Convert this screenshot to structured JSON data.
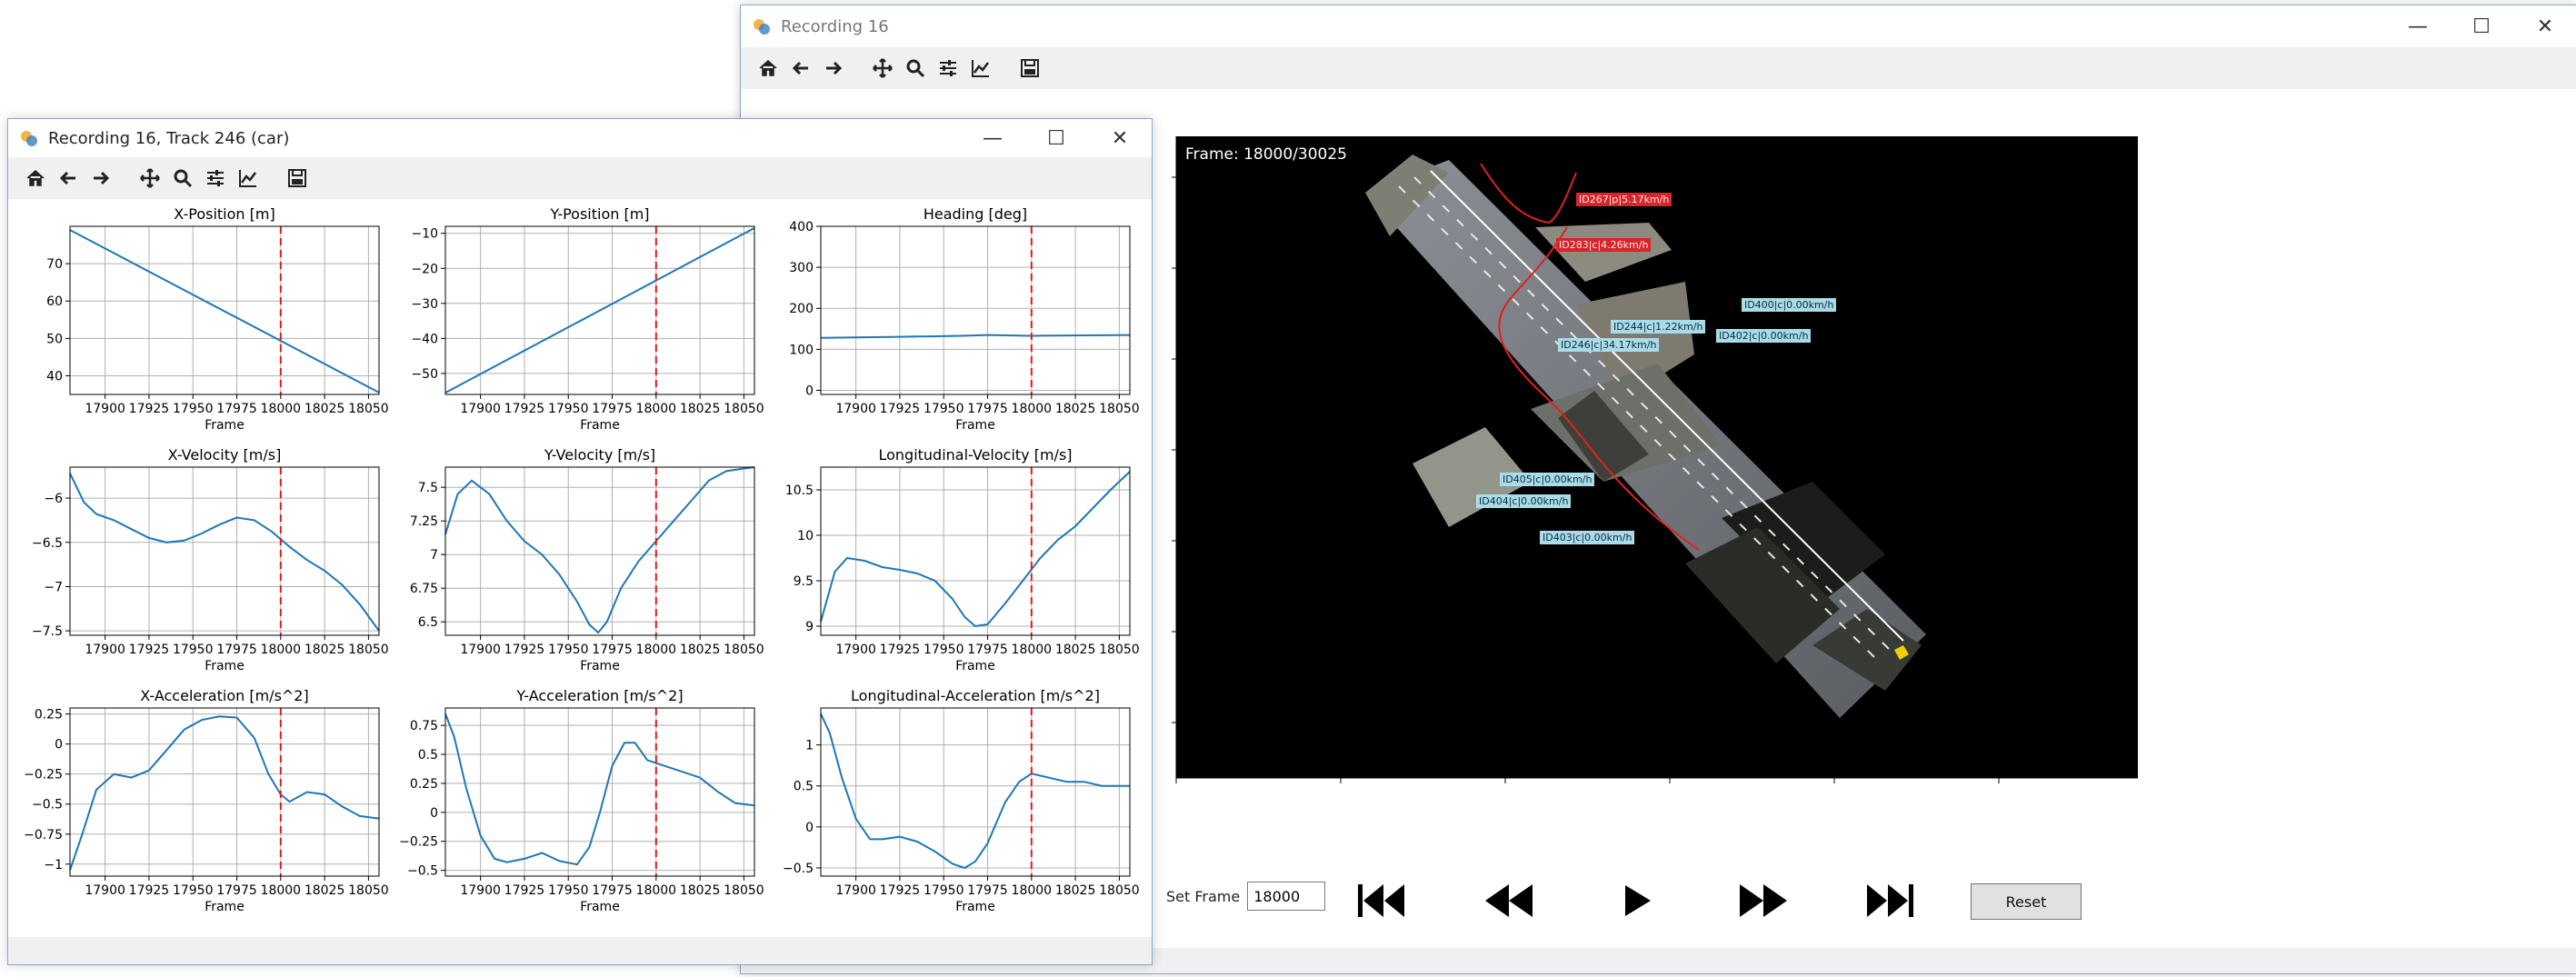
{
  "main_window": {
    "title": "Recording 16",
    "frame_text": "Frame: 18000/30025",
    "set_frame_label": "Set Frame",
    "set_frame_value": "18000",
    "reset_label": "Reset",
    "controls": {
      "first": "skip-to-start",
      "back": "rewind",
      "play": "play",
      "forward": "fast-forward",
      "last": "skip-to-end"
    },
    "track_labels": [
      {
        "text": "ID267|p|5.17km/h",
        "style": "red"
      },
      {
        "text": "ID283|c|4.26km/h",
        "style": "red"
      },
      {
        "text": "ID400|c|0.00km/h",
        "style": "car"
      },
      {
        "text": "ID244|c|1.22km/h",
        "style": "car"
      },
      {
        "text": "ID402|c|0.00km/h",
        "style": "car"
      },
      {
        "text": "ID246|c|34.17km/h",
        "style": "car"
      },
      {
        "text": "ID405|c|0.00km/h",
        "style": "car"
      },
      {
        "text": "ID404|c|0.00km/h",
        "style": "car"
      },
      {
        "text": "ID403|c|0.00km/h",
        "style": "car"
      }
    ]
  },
  "track_window": {
    "title": "Recording 16, Track 246 (car)"
  },
  "toolbar_icons": [
    "home-icon",
    "back-arrow-icon",
    "forward-arrow-icon",
    "pan-icon",
    "zoom-icon",
    "configure-subplots-icon",
    "edit-axes-icon",
    "save-icon"
  ],
  "chart_data": [
    {
      "type": "line",
      "title": "X-Position [m]",
      "xlabel": "Frame",
      "xlim": [
        17880,
        18056
      ],
      "ylim": [
        35,
        80
      ],
      "xticks": [
        17900,
        17925,
        17950,
        17975,
        18000,
        18025,
        18050
      ],
      "yticks": [
        40,
        50,
        60,
        70
      ],
      "series": [
        {
          "x": [
            17880,
            18056
          ],
          "y": [
            79,
            35.5
          ]
        }
      ],
      "marker_x": 18000
    },
    {
      "type": "line",
      "title": "Y-Position [m]",
      "xlabel": "Frame",
      "xlim": [
        17880,
        18056
      ],
      "ylim": [
        -56,
        -8
      ],
      "xticks": [
        17900,
        17925,
        17950,
        17975,
        18000,
        18025,
        18050
      ],
      "yticks": [
        -50,
        -40,
        -30,
        -20,
        -10
      ],
      "series": [
        {
          "x": [
            17880,
            18056
          ],
          "y": [
            -55.5,
            -8.5
          ]
        }
      ],
      "marker_x": 18000
    },
    {
      "type": "line",
      "title": "Heading [deg]",
      "xlabel": "Frame",
      "xlim": [
        17880,
        18056
      ],
      "ylim": [
        -10,
        400
      ],
      "xticks": [
        17900,
        17925,
        17950,
        17975,
        18000,
        18025,
        18050
      ],
      "yticks": [
        0,
        100,
        200,
        300,
        400
      ],
      "series": [
        {
          "x": [
            17880,
            17920,
            17960,
            17975,
            18000,
            18056
          ],
          "y": [
            128,
            130,
            133,
            135,
            133,
            135
          ]
        }
      ],
      "marker_x": 18000
    },
    {
      "type": "line",
      "title": "X-Velocity [m/s]",
      "xlabel": "Frame",
      "xlim": [
        17880,
        18056
      ],
      "ylim": [
        -7.55,
        -5.65
      ],
      "xticks": [
        17900,
        17925,
        17950,
        17975,
        18000,
        18025,
        18050
      ],
      "yticks": [
        -6.0,
        -6.5,
        -7.0,
        -7.5
      ],
      "series": [
        {
          "x": [
            17880,
            17888,
            17895,
            17905,
            17915,
            17925,
            17935,
            17945,
            17955,
            17965,
            17975,
            17985,
            17995,
            18005,
            18015,
            18025,
            18035,
            18045,
            18056
          ],
          "y": [
            -5.72,
            -6.05,
            -6.18,
            -6.25,
            -6.35,
            -6.45,
            -6.5,
            -6.48,
            -6.4,
            -6.3,
            -6.22,
            -6.25,
            -6.38,
            -6.55,
            -6.7,
            -6.82,
            -6.98,
            -7.2,
            -7.5
          ]
        }
      ],
      "marker_x": 18000
    },
    {
      "type": "line",
      "title": "Y-Velocity [m/s]",
      "xlabel": "Frame",
      "xlim": [
        17880,
        18056
      ],
      "ylim": [
        6.4,
        7.65
      ],
      "xticks": [
        17900,
        17925,
        17950,
        17975,
        18000,
        18025,
        18050
      ],
      "yticks": [
        6.5,
        6.75,
        7.0,
        7.25,
        7.5
      ],
      "series": [
        {
          "x": [
            17880,
            17887,
            17895,
            17905,
            17915,
            17925,
            17935,
            17945,
            17955,
            17962,
            17967,
            17972,
            17980,
            17990,
            18000,
            18010,
            18020,
            18030,
            18040,
            18050,
            18056
          ],
          "y": [
            7.15,
            7.45,
            7.55,
            7.45,
            7.25,
            7.1,
            7.0,
            6.85,
            6.65,
            6.48,
            6.42,
            6.5,
            6.75,
            6.95,
            7.1,
            7.25,
            7.4,
            7.55,
            7.62,
            7.64,
            7.65
          ]
        }
      ],
      "marker_x": 18000
    },
    {
      "type": "line",
      "title": "Longitudinal-Velocity [m/s]",
      "xlabel": "Frame",
      "xlim": [
        17880,
        18056
      ],
      "ylim": [
        8.9,
        10.75
      ],
      "xticks": [
        17900,
        17925,
        17950,
        17975,
        18000,
        18025,
        18050
      ],
      "yticks": [
        9.0,
        9.5,
        10.0,
        10.5
      ],
      "series": [
        {
          "x": [
            17880,
            17888,
            17895,
            17905,
            17915,
            17925,
            17935,
            17945,
            17955,
            17962,
            17968,
            17975,
            17985,
            17995,
            18005,
            18015,
            18025,
            18035,
            18045,
            18056
          ],
          "y": [
            9.05,
            9.6,
            9.75,
            9.72,
            9.65,
            9.62,
            9.58,
            9.5,
            9.3,
            9.1,
            9.0,
            9.02,
            9.25,
            9.5,
            9.75,
            9.95,
            10.1,
            10.3,
            10.5,
            10.7
          ]
        }
      ],
      "marker_x": 18000
    },
    {
      "type": "line",
      "title": "X-Acceleration [m/s^2]",
      "xlabel": "Frame",
      "xlim": [
        17880,
        18056
      ],
      "ylim": [
        -1.1,
        0.3
      ],
      "xticks": [
        17900,
        17925,
        17950,
        17975,
        18000,
        18025,
        18050
      ],
      "yticks": [
        0.25,
        0.0,
        -0.25,
        -0.5,
        -0.75,
        -1.0
      ],
      "series": [
        {
          "x": [
            17880,
            17887,
            17895,
            17905,
            17915,
            17925,
            17935,
            17945,
            17955,
            17965,
            17975,
            17985,
            17993,
            18000,
            18005,
            18015,
            18025,
            18035,
            18045,
            18056
          ],
          "y": [
            -1.05,
            -0.75,
            -0.38,
            -0.25,
            -0.28,
            -0.22,
            -0.05,
            0.12,
            0.2,
            0.23,
            0.22,
            0.05,
            -0.25,
            -0.42,
            -0.48,
            -0.4,
            -0.42,
            -0.52,
            -0.6,
            -0.62
          ]
        }
      ],
      "marker_x": 18000
    },
    {
      "type": "line",
      "title": "Y-Acceleration [m/s^2]",
      "xlabel": "Frame",
      "xlim": [
        17880,
        18056
      ],
      "ylim": [
        -0.55,
        0.9
      ],
      "xticks": [
        17900,
        17925,
        17950,
        17975,
        18000,
        18025,
        18050
      ],
      "yticks": [
        0.75,
        0.5,
        0.25,
        0.0,
        -0.25,
        -0.5
      ],
      "series": [
        {
          "x": [
            17880,
            17885,
            17892,
            17900,
            17908,
            17915,
            17925,
            17935,
            17945,
            17955,
            17962,
            17968,
            17975,
            17982,
            17988,
            17995,
            18005,
            18015,
            18025,
            18035,
            18045,
            18056
          ],
          "y": [
            0.85,
            0.65,
            0.2,
            -0.2,
            -0.4,
            -0.43,
            -0.4,
            -0.35,
            -0.42,
            -0.45,
            -0.3,
            0.0,
            0.4,
            0.6,
            0.6,
            0.45,
            0.4,
            0.35,
            0.3,
            0.18,
            0.08,
            0.06
          ]
        }
      ],
      "marker_x": 18000
    },
    {
      "type": "line",
      "title": "Longitudinal-Acceleration [m/s^2]",
      "xlabel": "Frame",
      "xlim": [
        17880,
        18056
      ],
      "ylim": [
        -0.6,
        1.45
      ],
      "xticks": [
        17900,
        17925,
        17950,
        17975,
        18000,
        18025,
        18050
      ],
      "yticks": [
        1.0,
        0.5,
        0.0,
        -0.5
      ],
      "series": [
        {
          "x": [
            17880,
            17885,
            17892,
            17900,
            17908,
            17915,
            17925,
            17935,
            17945,
            17955,
            17962,
            17968,
            17975,
            17985,
            17993,
            18000,
            18010,
            18020,
            18030,
            18040,
            18050,
            18056
          ],
          "y": [
            1.38,
            1.15,
            0.6,
            0.1,
            -0.15,
            -0.15,
            -0.12,
            -0.18,
            -0.3,
            -0.45,
            -0.5,
            -0.42,
            -0.2,
            0.3,
            0.55,
            0.65,
            0.6,
            0.55,
            0.55,
            0.5,
            0.5,
            0.5
          ]
        }
      ],
      "marker_x": 18000
    }
  ]
}
